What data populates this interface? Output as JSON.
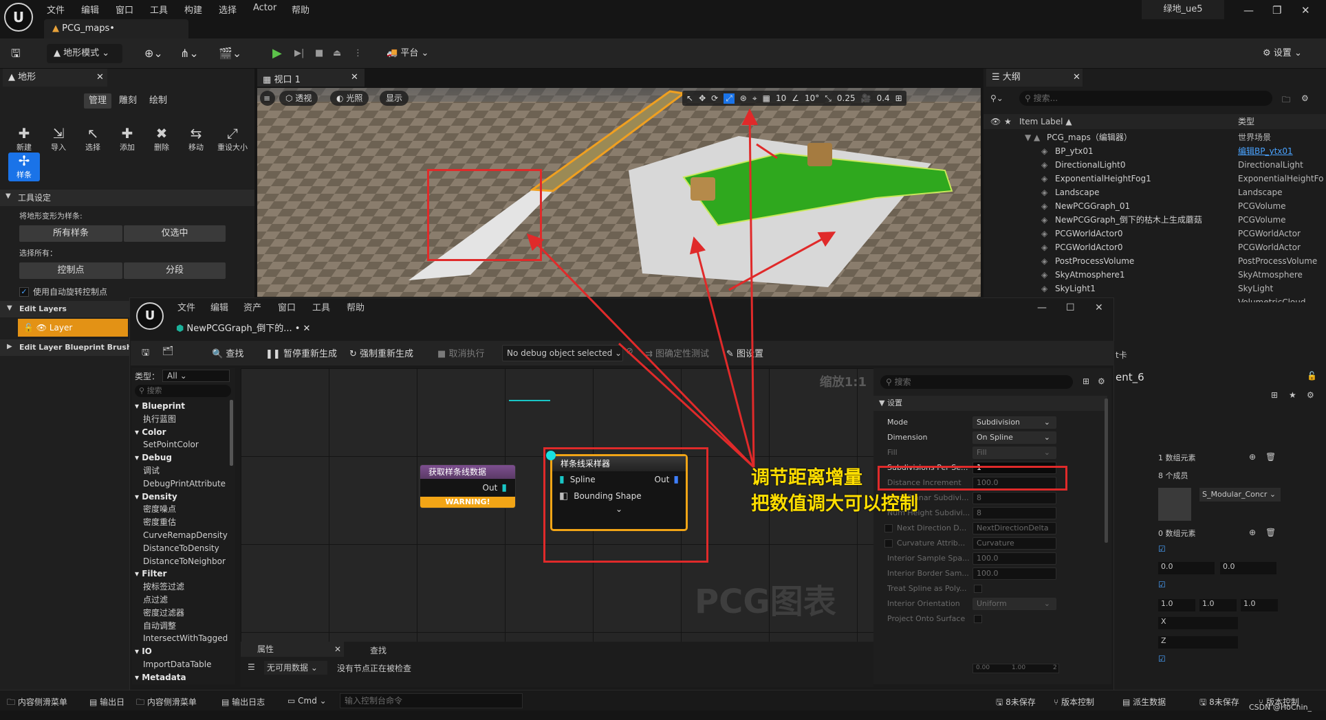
{
  "app": {
    "menu": [
      "文件",
      "编辑",
      "窗口",
      "工具",
      "构建",
      "选择",
      "Actor",
      "帮助"
    ],
    "doc_tab": "PCG_maps•",
    "project": "绿地_ue5",
    "window_controls": [
      "—",
      "❐",
      "✕"
    ]
  },
  "toolbar": {
    "mode": "地形模式",
    "platform": "平台",
    "settings": "设置"
  },
  "landscape": {
    "tab": "地形",
    "modes": [
      "管理",
      "雕刻",
      "绘制"
    ],
    "tools": [
      "新建",
      "导入",
      "选择",
      "添加",
      "删除",
      "移动",
      "重设大小"
    ],
    "active_tool": "样条",
    "tool_settings": "工具设定",
    "deform_label": "将地形变形为样条:",
    "btn_all_splines": "所有样条",
    "btn_selected_only": "仅选中",
    "select_all_label": "选择所有：",
    "btn_control_points": "控制点",
    "btn_segments": "分段",
    "auto_rotate": "使用自动旋转控制点",
    "edit_layers": "Edit Layers",
    "layer_name": "Layer",
    "edit_layer_brushes": "Edit Layer Blueprint Brushes"
  },
  "viewport": {
    "tab": "视口 1",
    "chips": [
      "透视",
      "光照",
      "显示"
    ],
    "grid": "10",
    "angle": "10°",
    "scale": "0.25",
    "camera": "0.4"
  },
  "outliner": {
    "tab": "大纲",
    "search_placeholder": "搜索...",
    "col_label": "Item Label ▲",
    "col_type": "类型",
    "rows": [
      {
        "name": "PCG_maps（编辑器）",
        "type": "世界场景"
      },
      {
        "name": "BP_ytx01",
        "type": "编辑BP_ytx01"
      },
      {
        "name": "DirectionalLight0",
        "type": "DirectionalLight"
      },
      {
        "name": "ExponentialHeightFog1",
        "type": "ExponentialHeightFo"
      },
      {
        "name": "Landscape",
        "type": "Landscape"
      },
      {
        "name": "NewPCGGraph_01",
        "type": "PCGVolume"
      },
      {
        "name": "NewPCGGraph_倒下的枯木上生成蘑菇",
        "type": "PCGVolume"
      },
      {
        "name": "PCGWorldActor0",
        "type": "PCGWorldActor"
      },
      {
        "name": "PCGWorldActor0",
        "type": "PCGWorldActor"
      },
      {
        "name": "PostProcessVolume",
        "type": "PostProcessVolume"
      },
      {
        "name": "SkyAtmosphere1",
        "type": "SkyAtmosphere"
      },
      {
        "name": "SkyLight1",
        "type": "SkyLight"
      },
      {
        "name": "",
        "type": "VolumetricCloud"
      }
    ]
  },
  "details_right": {
    "partial_tab": "t卡",
    "partial_title": "ent_6",
    "array1": "1 数组元素",
    "members": "8 个成员",
    "material": "S_Modular_Concr",
    "array0": "0 数组元素",
    "v00a": "0.0",
    "v00b": "0.0",
    "v10a": "1.0",
    "v10b": "1.0",
    "v10c": "1.0",
    "axis_x": "X",
    "axis_z": "Z"
  },
  "pcg": {
    "menu": [
      "文件",
      "编辑",
      "资产",
      "窗口",
      "工具",
      "帮助"
    ],
    "tab": "NewPCGGraph_倒下的...",
    "toolbar": {
      "find": "查找",
      "pause": "暂停重新生成",
      "force": "强制重新生成",
      "cancel": "取消执行",
      "debug": "No debug object selected",
      "determinism": "图确定性测试",
      "graph_settings": "图设置"
    },
    "palette": {
      "type_label": "类型：",
      "type_value": "All",
      "search": "搜索",
      "items": [
        {
          "t": "Blueprint",
          "cat": true
        },
        {
          "t": "执行蓝图",
          "cat": false
        },
        {
          "t": "Color",
          "cat": true
        },
        {
          "t": "SetPointColor",
          "cat": false
        },
        {
          "t": "Debug",
          "cat": true
        },
        {
          "t": "调试",
          "cat": false
        },
        {
          "t": "DebugPrintAttribute",
          "cat": false
        },
        {
          "t": "Density",
          "cat": true
        },
        {
          "t": "密度噪点",
          "cat": false
        },
        {
          "t": "密度重估",
          "cat": false
        },
        {
          "t": "CurveRemapDensity",
          "cat": false
        },
        {
          "t": "DistanceToDensity",
          "cat": false
        },
        {
          "t": "DistanceToNeighbor",
          "cat": false
        },
        {
          "t": "Filter",
          "cat": true
        },
        {
          "t": "按标签过滤",
          "cat": false
        },
        {
          "t": "点过滤",
          "cat": false
        },
        {
          "t": "密度过滤器",
          "cat": false
        },
        {
          "t": "自动调整",
          "cat": false
        },
        {
          "t": "IntersectWithTagged",
          "cat": false
        },
        {
          "t": "IO",
          "cat": true
        },
        {
          "t": "ImportDataTable",
          "cat": false
        },
        {
          "t": "Metadata",
          "cat": true
        }
      ]
    },
    "graph": {
      "zoom": "缩放1:1",
      "watermark": "PCG图表",
      "node1_title": "获取样条线数据",
      "node1_out": "Out",
      "node1_warning": "WARNING!",
      "node2_title": "样条线采样器",
      "node2_in1": "Spline",
      "node2_in2": "Bounding Shape",
      "node2_out": "Out"
    },
    "bottom": {
      "tab_props": "属性",
      "tab_find": "查找",
      "no_data": "无可用数据",
      "no_node": "没有节点正在被检查"
    },
    "settings": {
      "search": "搜索",
      "section": "设置",
      "rows": [
        {
          "label": "Mode",
          "value": "Subdivision",
          "drop": true,
          "dim": false
        },
        {
          "label": "Dimension",
          "value": "On Spline",
          "drop": true,
          "dim": false
        },
        {
          "label": "Fill",
          "value": "Fill",
          "drop": true,
          "dim": true
        },
        {
          "label": "Subdivisions Per Se...",
          "value": "1",
          "drop": false,
          "dim": false
        },
        {
          "label": "Distance Increment",
          "value": "100.0",
          "drop": false,
          "dim": true
        },
        {
          "label": "Num Planar Subdivi...",
          "value": "8",
          "drop": false,
          "dim": true
        },
        {
          "label": "Num Height Subdivi...",
          "value": "8",
          "drop": false,
          "dim": true
        },
        {
          "label": "Next Direction D...",
          "value": "NextDirectionDelta",
          "drop": false,
          "dim": true
        },
        {
          "label": "Curvature Attrib...",
          "value": "Curvature",
          "drop": false,
          "dim": true
        },
        {
          "label": "Interior Sample Spa...",
          "value": "100.0",
          "drop": false,
          "dim": true
        },
        {
          "label": "Interior Border Sam...",
          "value": "100.0",
          "drop": false,
          "dim": true
        },
        {
          "label": "Treat Spline as Poly...",
          "value": "",
          "drop": false,
          "dim": true
        },
        {
          "label": "Interior Orientation",
          "value": "Uniform",
          "drop": true,
          "dim": true
        },
        {
          "label": "Project Onto Surface",
          "value": "",
          "drop": false,
          "dim": true
        }
      ],
      "slider_min": "0.00",
      "slider_mid": "1.00",
      "slider_max": "2"
    }
  },
  "annotation": {
    "line1": "调节距离增量",
    "line2": "把数值调大可以控制"
  },
  "statusbar": {
    "content_drawer": "内容侧滑菜单",
    "output": "输出日",
    "pcg_content": "内容侧滑菜单",
    "pcg_output": "输出日志",
    "cmd": "Cmd",
    "cmd_placeholder": "输入控制台命令",
    "unsaved": "8未保存",
    "source_control": "版本控制",
    "derived": "派生数据",
    "unsaved2": "8未保存",
    "source_control2": "版本控制",
    "watermark": "CSDN @HoChin_"
  }
}
